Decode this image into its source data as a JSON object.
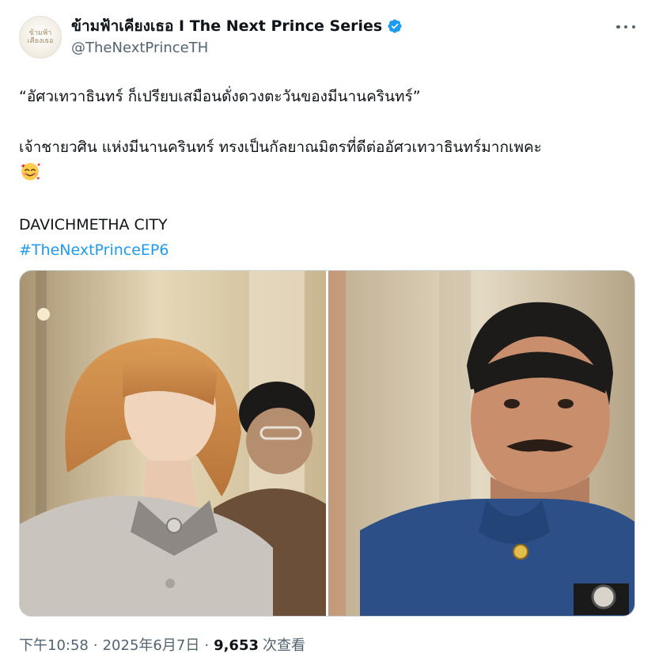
{
  "account": {
    "display_name": "ข้ามฟ้าเคียงเธอ I The Next Prince Series",
    "handle": "@TheNextPrinceTH",
    "avatar_logo_lines": [
      "ข้ามฟ้า",
      "เคียงเธอ"
    ],
    "verified_icon": "verified-badge-icon",
    "verified_color": "#1d9bf0"
  },
  "menu": {
    "icon": "more-options-icon"
  },
  "tweet": {
    "line1": "“อัศวเทวาธินทร์ ก็เปรียบเสมือนดั่งดวงตะวันของมีนานครินทร์”",
    "line2": "เจ้าชายวศิน แห่งมีนานครินทร์ ทรงเป็นกัลยาณมิตรที่ดีต่ออัศวเทวาธินทร์มากเพคะ",
    "emoji": "smiling-face-with-hearts",
    "line3": "DAVICHMETHA CITY",
    "hashtag": "#TheNextPrinceEP6",
    "hashtag_color": "#1d9bf0"
  },
  "media": {
    "photo_count": 2
  },
  "footer": {
    "time": "下午10:58",
    "separator": "·",
    "date": "2025年6月7日",
    "views_count": "9,653",
    "views_label": "次查看"
  }
}
